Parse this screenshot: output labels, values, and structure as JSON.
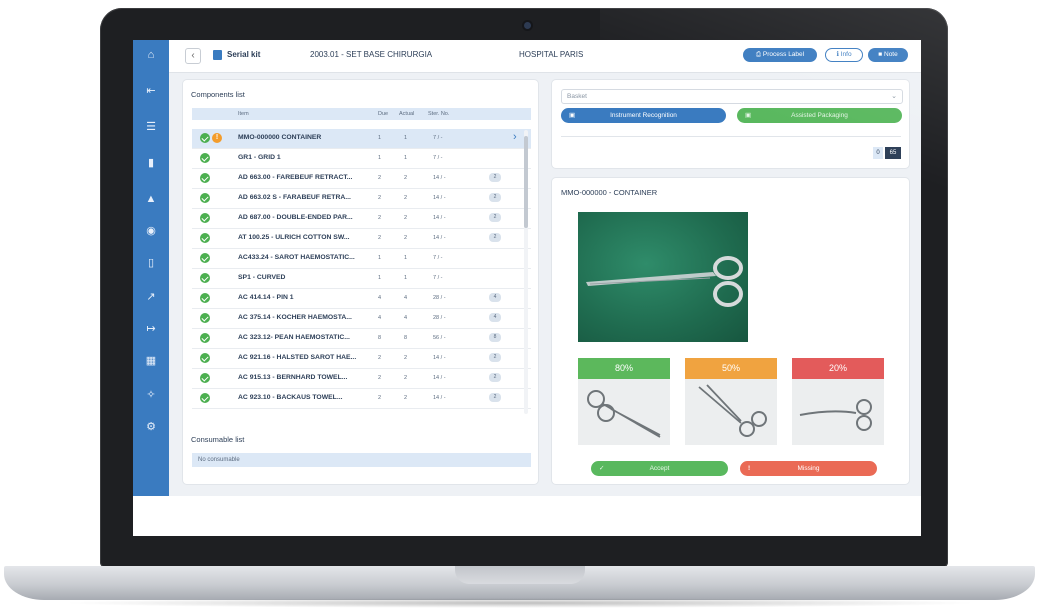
{
  "header": {
    "kit_title": "Serial kit",
    "set_title": "2003.01 - SET BASE CHIRURGIA",
    "hospital": "HOSPITAL PARIS",
    "process_label": "Process Label",
    "info_label": "Info",
    "note_label": "Note"
  },
  "components": {
    "title": "Components list",
    "columns": {
      "item": "Item",
      "due": "Due",
      "actual": "Actual",
      "ster": "Ster. No."
    },
    "rows": [
      {
        "name": "MMO-000000 CONTAINER",
        "due": "1",
        "actual": "1",
        "ster": "7 / -",
        "badge": ""
      },
      {
        "name": "GR1 - GRID 1",
        "due": "1",
        "actual": "1",
        "ster": "7 / -",
        "badge": ""
      },
      {
        "name": "AD 663.00 - FAREBEUF RETRACT...",
        "due": "2",
        "actual": "2",
        "ster": "14 / -",
        "badge": "2"
      },
      {
        "name": "AD 663.02 S - FARABEUF RETRA...",
        "due": "2",
        "actual": "2",
        "ster": "14 / -",
        "badge": "2"
      },
      {
        "name": "AD 687.00 - DOUBLE-ENDED PAR...",
        "due": "2",
        "actual": "2",
        "ster": "14 / -",
        "badge": "2"
      },
      {
        "name": "AT 100.25 - ULRICH COTTON SW...",
        "due": "2",
        "actual": "2",
        "ster": "14 / -",
        "badge": "2"
      },
      {
        "name": "AC433.24 - SAROT HAEMOSTATIC...",
        "due": "1",
        "actual": "1",
        "ster": "7 / -",
        "badge": ""
      },
      {
        "name": "SP1 - CURVED",
        "due": "1",
        "actual": "1",
        "ster": "7 / -",
        "badge": ""
      },
      {
        "name": "AC 414.14 - PIN 1",
        "due": "4",
        "actual": "4",
        "ster": "28 / -",
        "badge": "4"
      },
      {
        "name": "AC 375.14 - KOCHER HAEMOSTA...",
        "due": "4",
        "actual": "4",
        "ster": "28 / -",
        "badge": "4"
      },
      {
        "name": "AC 323.12- PEAN HAEMOSTATIC...",
        "due": "8",
        "actual": "8",
        "ster": "56 / -",
        "badge": "8"
      },
      {
        "name": "AC 921.16 - HALSTED SAROT HAE...",
        "due": "2",
        "actual": "2",
        "ster": "14 / -",
        "badge": "2"
      },
      {
        "name": "AC 915.13 - BERNHARD TOWEL...",
        "due": "2",
        "actual": "2",
        "ster": "14 / -",
        "badge": "2"
      },
      {
        "name": "AC 923.10 - BACKAUS TOWEL...",
        "due": "2",
        "actual": "2",
        "ster": "14 / -",
        "badge": "2"
      }
    ]
  },
  "consumables": {
    "title": "Consumable list",
    "empty": "No consumable"
  },
  "recognition": {
    "basket_placeholder": "Basket",
    "instrument_recognition": "Instrument Recognition",
    "assisted_packaging": "Assisted Packaging",
    "count_current": "0",
    "count_total": "65"
  },
  "detail": {
    "title": "MMO-000000 - CONTAINER",
    "matches": [
      {
        "percent": "80%",
        "color": "#5cb85c"
      },
      {
        "percent": "50%",
        "color": "#f0a340"
      },
      {
        "percent": "20%",
        "color": "#e35b5b"
      }
    ],
    "accept": "Accept",
    "missing": "Missing"
  },
  "colors": {
    "primary": "#3a7bc0",
    "success": "#59b85e",
    "danger": "#ea6a55",
    "warning": "#f39c2b"
  },
  "icons": {
    "sidebar": [
      "home-icon",
      "login-icon",
      "list-icon",
      "book-icon",
      "flask-icon",
      "box-icon",
      "document-icon",
      "arrow-icon",
      "export-icon",
      "chart-icon",
      "users-icon",
      "settings-icon"
    ]
  }
}
